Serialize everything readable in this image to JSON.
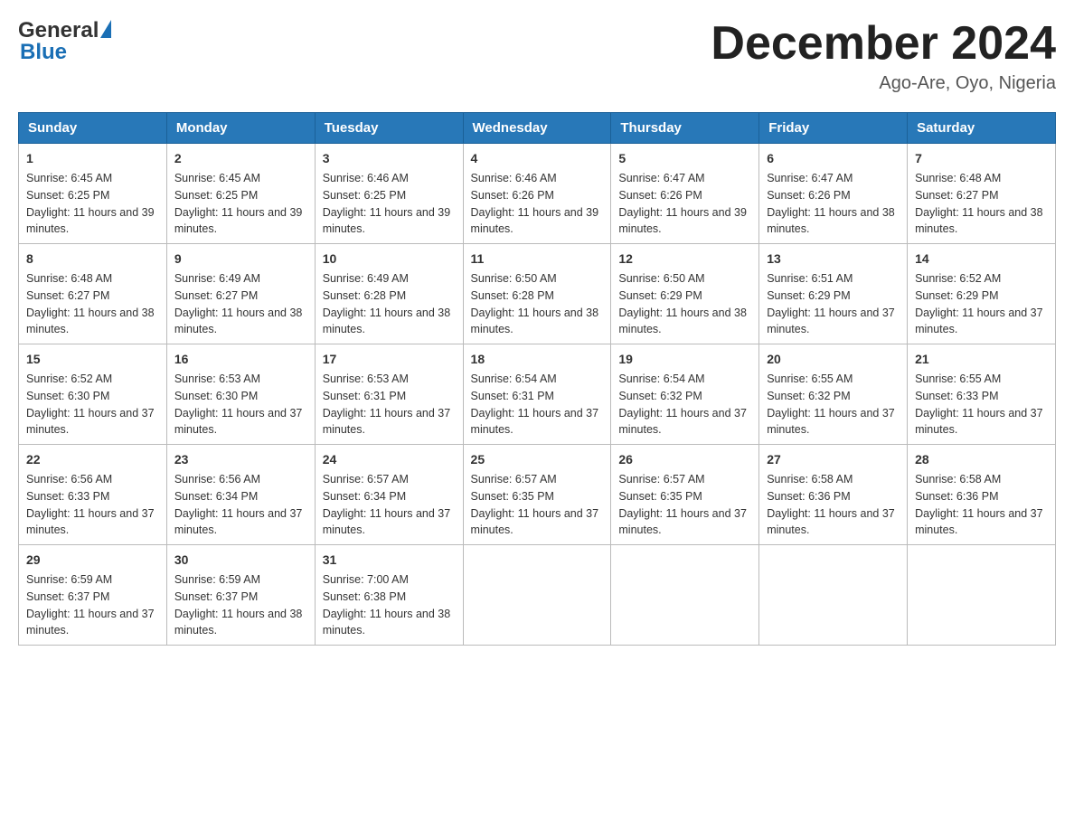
{
  "header": {
    "logo_general": "General",
    "logo_blue": "Blue",
    "month_title": "December 2024",
    "location": "Ago-Are, Oyo, Nigeria"
  },
  "days_of_week": [
    "Sunday",
    "Monday",
    "Tuesday",
    "Wednesday",
    "Thursday",
    "Friday",
    "Saturday"
  ],
  "weeks": [
    [
      {
        "day": "1",
        "sunrise": "6:45 AM",
        "sunset": "6:25 PM",
        "daylight": "11 hours and 39 minutes."
      },
      {
        "day": "2",
        "sunrise": "6:45 AM",
        "sunset": "6:25 PM",
        "daylight": "11 hours and 39 minutes."
      },
      {
        "day": "3",
        "sunrise": "6:46 AM",
        "sunset": "6:25 PM",
        "daylight": "11 hours and 39 minutes."
      },
      {
        "day": "4",
        "sunrise": "6:46 AM",
        "sunset": "6:26 PM",
        "daylight": "11 hours and 39 minutes."
      },
      {
        "day": "5",
        "sunrise": "6:47 AM",
        "sunset": "6:26 PM",
        "daylight": "11 hours and 39 minutes."
      },
      {
        "day": "6",
        "sunrise": "6:47 AM",
        "sunset": "6:26 PM",
        "daylight": "11 hours and 38 minutes."
      },
      {
        "day": "7",
        "sunrise": "6:48 AM",
        "sunset": "6:27 PM",
        "daylight": "11 hours and 38 minutes."
      }
    ],
    [
      {
        "day": "8",
        "sunrise": "6:48 AM",
        "sunset": "6:27 PM",
        "daylight": "11 hours and 38 minutes."
      },
      {
        "day": "9",
        "sunrise": "6:49 AM",
        "sunset": "6:27 PM",
        "daylight": "11 hours and 38 minutes."
      },
      {
        "day": "10",
        "sunrise": "6:49 AM",
        "sunset": "6:28 PM",
        "daylight": "11 hours and 38 minutes."
      },
      {
        "day": "11",
        "sunrise": "6:50 AM",
        "sunset": "6:28 PM",
        "daylight": "11 hours and 38 minutes."
      },
      {
        "day": "12",
        "sunrise": "6:50 AM",
        "sunset": "6:29 PM",
        "daylight": "11 hours and 38 minutes."
      },
      {
        "day": "13",
        "sunrise": "6:51 AM",
        "sunset": "6:29 PM",
        "daylight": "11 hours and 37 minutes."
      },
      {
        "day": "14",
        "sunrise": "6:52 AM",
        "sunset": "6:29 PM",
        "daylight": "11 hours and 37 minutes."
      }
    ],
    [
      {
        "day": "15",
        "sunrise": "6:52 AM",
        "sunset": "6:30 PM",
        "daylight": "11 hours and 37 minutes."
      },
      {
        "day": "16",
        "sunrise": "6:53 AM",
        "sunset": "6:30 PM",
        "daylight": "11 hours and 37 minutes."
      },
      {
        "day": "17",
        "sunrise": "6:53 AM",
        "sunset": "6:31 PM",
        "daylight": "11 hours and 37 minutes."
      },
      {
        "day": "18",
        "sunrise": "6:54 AM",
        "sunset": "6:31 PM",
        "daylight": "11 hours and 37 minutes."
      },
      {
        "day": "19",
        "sunrise": "6:54 AM",
        "sunset": "6:32 PM",
        "daylight": "11 hours and 37 minutes."
      },
      {
        "day": "20",
        "sunrise": "6:55 AM",
        "sunset": "6:32 PM",
        "daylight": "11 hours and 37 minutes."
      },
      {
        "day": "21",
        "sunrise": "6:55 AM",
        "sunset": "6:33 PM",
        "daylight": "11 hours and 37 minutes."
      }
    ],
    [
      {
        "day": "22",
        "sunrise": "6:56 AM",
        "sunset": "6:33 PM",
        "daylight": "11 hours and 37 minutes."
      },
      {
        "day": "23",
        "sunrise": "6:56 AM",
        "sunset": "6:34 PM",
        "daylight": "11 hours and 37 minutes."
      },
      {
        "day": "24",
        "sunrise": "6:57 AM",
        "sunset": "6:34 PM",
        "daylight": "11 hours and 37 minutes."
      },
      {
        "day": "25",
        "sunrise": "6:57 AM",
        "sunset": "6:35 PM",
        "daylight": "11 hours and 37 minutes."
      },
      {
        "day": "26",
        "sunrise": "6:57 AM",
        "sunset": "6:35 PM",
        "daylight": "11 hours and 37 minutes."
      },
      {
        "day": "27",
        "sunrise": "6:58 AM",
        "sunset": "6:36 PM",
        "daylight": "11 hours and 37 minutes."
      },
      {
        "day": "28",
        "sunrise": "6:58 AM",
        "sunset": "6:36 PM",
        "daylight": "11 hours and 37 minutes."
      }
    ],
    [
      {
        "day": "29",
        "sunrise": "6:59 AM",
        "sunset": "6:37 PM",
        "daylight": "11 hours and 37 minutes."
      },
      {
        "day": "30",
        "sunrise": "6:59 AM",
        "sunset": "6:37 PM",
        "daylight": "11 hours and 38 minutes."
      },
      {
        "day": "31",
        "sunrise": "7:00 AM",
        "sunset": "6:38 PM",
        "daylight": "11 hours and 38 minutes."
      },
      null,
      null,
      null,
      null
    ]
  ]
}
